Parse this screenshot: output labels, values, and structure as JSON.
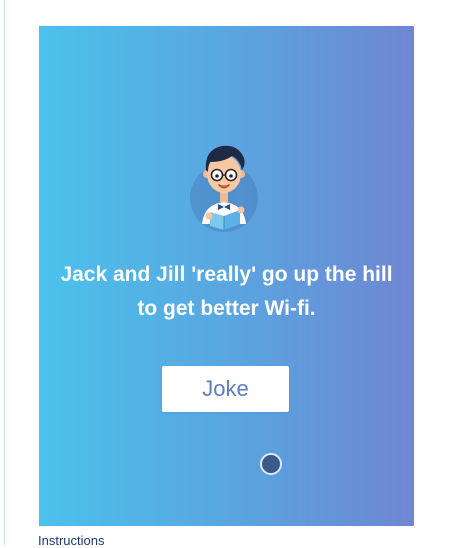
{
  "card": {
    "joke_text": "Jack and Jill 'really' go up the hill to get better Wi-fi.",
    "button_label": "Joke",
    "avatar_icon": "boy-reading-book-icon",
    "indicator_icon": "dot-indicator"
  },
  "caption": {
    "text": "Instructions"
  },
  "colors": {
    "gradient_start": "#4bc2ec",
    "gradient_end": "#6f86d2",
    "button_text": "#5b7fbf",
    "dot": "#3a5a8c"
  }
}
